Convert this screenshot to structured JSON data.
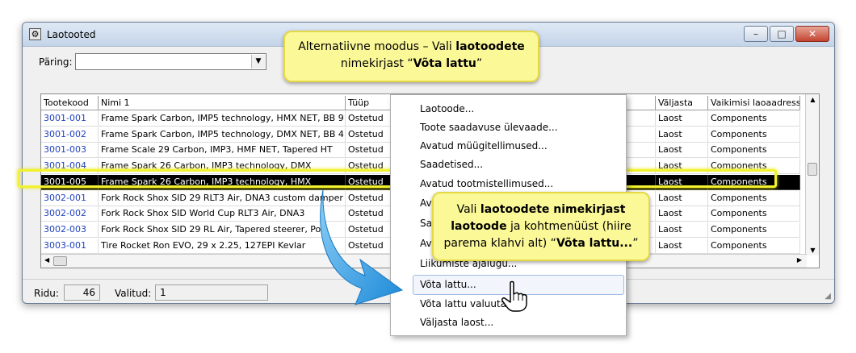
{
  "window": {
    "title": "Laotooted",
    "app_icon": "gear-icon",
    "buttons": [
      "minimize",
      "maximize",
      "close"
    ]
  },
  "query": {
    "label": "Päring:",
    "value": ""
  },
  "grid": {
    "columns": [
      "Tootekood",
      "Nimi 1",
      "Tüüp",
      "Väljasta",
      "Vaikimisi laoaadress"
    ],
    "rows": [
      {
        "code": "3001-001",
        "name": "Frame Spark Carbon, IMP5 technology, HMX NET, BB 9",
        "type": "Ostetud",
        "issue": "Laost",
        "address": "Components"
      },
      {
        "code": "3001-002",
        "name": "Frame Spark Carbon, IMP5 technology, DMX NET, BB 4",
        "type": "Ostetud",
        "issue": "Laost",
        "address": "Components"
      },
      {
        "code": "3001-003",
        "name": "Frame Scale 29 Carbon, IMP3, HMF NET, Tapered HT",
        "type": "Ostetud",
        "issue": "Laost",
        "address": "Components"
      },
      {
        "code": "3001-004",
        "name": "Frame Spark 26 Carbon, IMP3 technology, DMX",
        "type": "Ostetud",
        "issue": "Laost",
        "address": "Components"
      },
      {
        "code": "3001-005",
        "name": "Frame Spark 26 Carbon, IMP3 technology, HMX",
        "type": "Ostetud",
        "issue": "Laost",
        "address": "Components"
      },
      {
        "code": "3002-001",
        "name": "Fork Rock Shox SID 29 RLT3 Air, DNA3 custom damper",
        "type": "Ostetud",
        "issue": "Laost",
        "address": "Components"
      },
      {
        "code": "3002-002",
        "name": "Fork Rock Shox SID World Cup RLT3 Air, DNA3",
        "type": "Ostetud",
        "issue": "Laost",
        "address": "Components"
      },
      {
        "code": "3002-003",
        "name": "Fork Rock Shox SID 29 RL Air, Tapered steerer, Pop",
        "type": "Ostetud",
        "issue": "Laost",
        "address": "Components"
      },
      {
        "code": "3003-001",
        "name": "Tire Rocket Ron EVO, 29 x 2.25, 127EPI Kevlar",
        "type": "Ostetud",
        "issue": "Laost",
        "address": "Components"
      }
    ],
    "selected_row": "3001-005"
  },
  "status": {
    "rows_label": "Ridu:",
    "rows_value": "46",
    "selected_label": "Valitud:",
    "selected_value": "1"
  },
  "context_menu": {
    "items": [
      "Laotoode...",
      "Toote saadavuse ülevaade...",
      "Avatud müügitellimused...",
      "Saadetised...",
      "Avatud tootmistellimused...",
      "Av",
      "Saa",
      "Av",
      "Liikumiste ajalugu...",
      "Võta lattu...",
      "Võta lattu valuuta",
      "Väljasta laost..."
    ],
    "hovered": "Võta lattu..."
  },
  "callouts": {
    "first": {
      "pre": "Alternatiivne moodus – Vali ",
      "bold1": "laotoodete",
      "mid": " nimekirjast “",
      "bold2": "Võta lattu",
      "post": "”"
    },
    "second": {
      "pre": "Vali ",
      "bold1": "laotoodete nimekirjast laotoode",
      "mid": " ja kohtmenüüst (hiire parema klahvi alt) “",
      "bold2": "Võta lattu...",
      "post": "”"
    }
  },
  "colors": {
    "accent_code": "#1f3fbf",
    "callout_fill": "#fbf898",
    "selection_frame": "#f2f22e",
    "arrow_blue": "#2d9be0"
  },
  "icons": {
    "arrow": "arrow-down-icon",
    "pointer": "hand-pointer-icon"
  }
}
